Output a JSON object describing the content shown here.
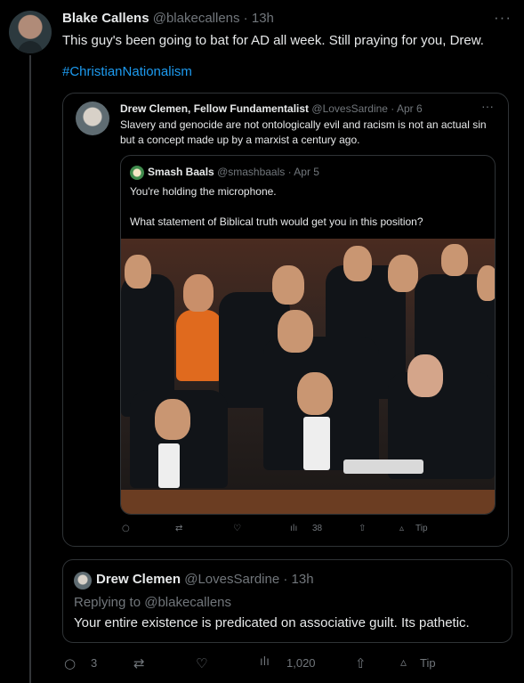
{
  "tweet": {
    "display_name": "Blake Callens",
    "handle": "@blakecallens",
    "time": "13h",
    "text": "This guy's been going to bat for AD all week. Still praying for you, Drew.",
    "hashtag": "#ChristianNationalism",
    "more_icon": "more-icon"
  },
  "quoted": {
    "display_name": "Drew Clemen, Fellow Fundamentalist",
    "handle": "@LovesSardine",
    "date": "Apr 6",
    "text": "Slavery and genocide are not ontologically evil and racism is not an actual sin but a concept made up by a marxist a century ago.",
    "inner": {
      "display_name": "Smash Baals",
      "handle": "@smashbaals",
      "date": "Apr 5",
      "line1": "You're holding the microphone.",
      "line2": "What statement of Biblical truth would get you in this position?"
    },
    "actions": {
      "views": "38",
      "tip": "Tip"
    }
  },
  "reply": {
    "display_name": "Drew Clemen",
    "handle": "@LovesSardine",
    "time": "13h",
    "replying_prefix": "Replying to",
    "replying_handle": "@blakecallens",
    "text": "Your entire existence is predicated on associative guilt. Its pathetic."
  },
  "actions": {
    "replies": "3",
    "views": "1,020",
    "tip": "Tip"
  },
  "colors": {
    "background": "#000000",
    "text": "#e7e9ea",
    "muted": "#71767b",
    "accent": "#1d9bf0",
    "border": "#2f3336"
  }
}
